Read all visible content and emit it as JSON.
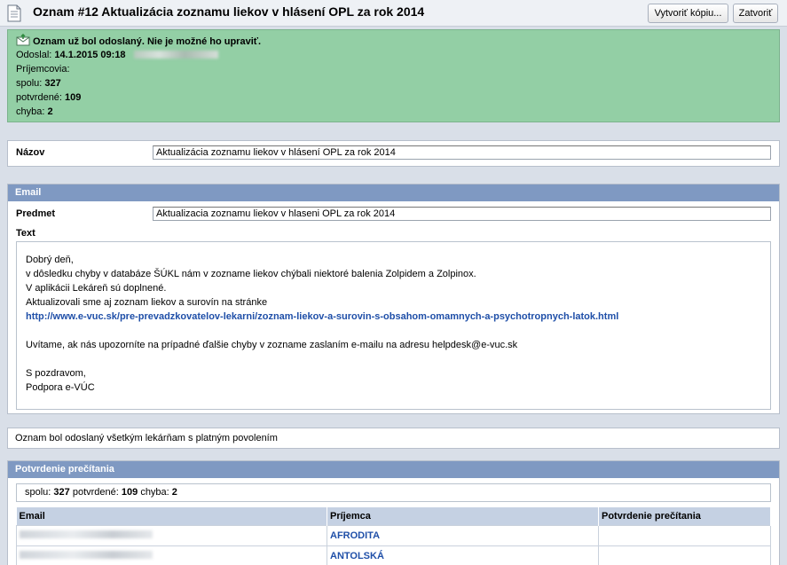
{
  "header": {
    "title": "Oznam #12 Aktualizácia zoznamu liekov v hlásení OPL za rok 2014",
    "copy_button": "Vytvoriť kópiu...",
    "close_button": "Zatvoriť",
    "icon": "document-icon"
  },
  "status": {
    "message": "Oznam už bol odoslaný. Nie je možné ho upraviť.",
    "sent_label": "Odoslal:",
    "sent_datetime": "14.1.2015 09:18",
    "recipients_label": "Príjemcovia:",
    "total_label": "spolu:",
    "total_value": "327",
    "confirmed_label": "potvrdené:",
    "confirmed_value": "109",
    "error_label": "chyba:",
    "error_value": "2",
    "color": "#93cfa5"
  },
  "name_section": {
    "label": "Názov",
    "value": "Aktualizácia zoznamu liekov v hlásení OPL za rok 2014"
  },
  "email_section": {
    "heading": "Email",
    "subject_label": "Predmet",
    "subject_value": "Aktualizacia zoznamu liekov v hlaseni OPL za rok 2014",
    "text_label": "Text",
    "body": {
      "l1": "Dobrý deň,",
      "l2": "v dôsledku chyby v databáze ŠÚKL nám v zozname liekov chýbali niektoré balenia Zolpidem a Zolpinox.",
      "l3": "V aplikácii Lekáreň sú doplnené.",
      "l4": "Aktualizovali sme aj zoznam liekov a surovín na stránke",
      "link": "http://www.e-vuc.sk/pre-prevadzkovatelov-lekarni/zoznam-liekov-a-surovin-s-obsahom-omamnych-a-psychotropnych-latok.html",
      "l6": "Uvítame, ak nás upozorníte na prípadné ďalšie chyby v zozname zaslaním e-mailu na adresu helpdesk@e-vuc.sk",
      "l8": "S pozdravom,",
      "l9": "Podpora e-VÚC"
    }
  },
  "info": {
    "text": "Oznam bol odoslaný všetkým lekárňam s platným povolením"
  },
  "confirmation": {
    "heading": "Potvrdenie prečítania",
    "summary": {
      "total_label": "spolu:",
      "total_value": "327",
      "confirmed_label": "potvrdené:",
      "confirmed_value": "109",
      "error_label": "chyba:",
      "error_value": "2"
    },
    "columns": {
      "email": "Email",
      "recipient": "Príjemca",
      "confirmation": "Potvrdenie prečítania"
    },
    "rows": [
      {
        "email": "",
        "recipient": "AFRODITA",
        "confirmation": ""
      },
      {
        "email": "",
        "recipient": "ANTOLSKÁ",
        "confirmation": ""
      }
    ]
  }
}
